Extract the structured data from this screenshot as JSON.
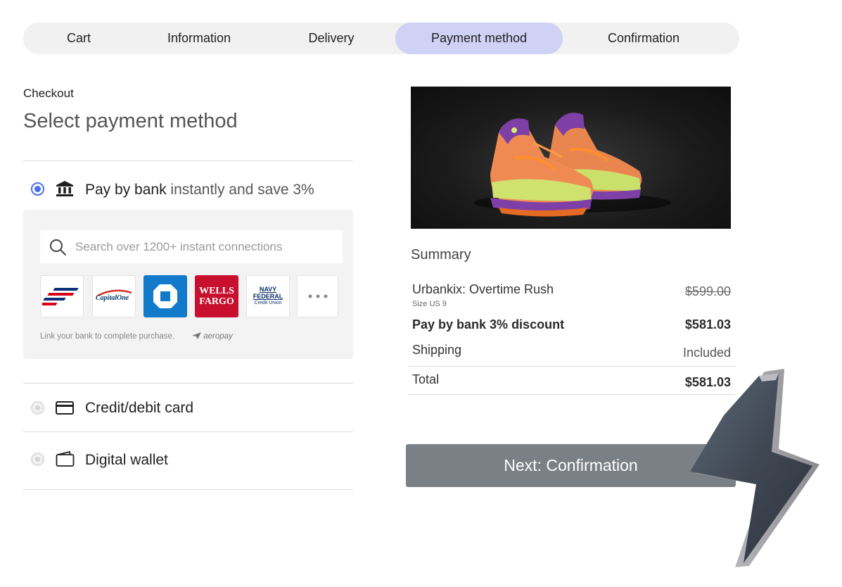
{
  "stepper": {
    "steps": [
      {
        "label": "Cart",
        "active": false
      },
      {
        "label": "Information",
        "active": false
      },
      {
        "label": "Delivery",
        "active": false
      },
      {
        "label": "Payment method",
        "active": true
      },
      {
        "label": "Confirmation",
        "active": false
      }
    ]
  },
  "checkout": {
    "eyebrow": "Checkout",
    "title": "Select payment method"
  },
  "methods": {
    "bank": {
      "label_strong": "Pay by bank",
      "label_soft": " instantly and save 3%",
      "selected": true,
      "icon": "bank-icon",
      "search_placeholder": "Search over 1200+ instant connections",
      "banks": [
        {
          "name": "Bank of America",
          "icon": "bank-of-america-logo"
        },
        {
          "name": "Capital One",
          "text": "CapitalOne"
        },
        {
          "name": "Chase",
          "icon": "chase-logo"
        },
        {
          "name": "Wells Fargo",
          "line1": "WELLS",
          "line2": "FARGO"
        },
        {
          "name": "Navy Federal Credit Union",
          "line1": "NAVY",
          "line2": "FEDERAL",
          "line3": "Credit Union"
        },
        {
          "name": "More banks",
          "icon": "more-dots-icon"
        }
      ],
      "footer_note": "Link your bank to complete purchase.",
      "provider": "aeropay"
    },
    "card": {
      "label": "Credit/debit card",
      "selected": false,
      "icon": "credit-card-icon"
    },
    "wallet": {
      "label": "Digital wallet",
      "selected": false,
      "icon": "wallet-icon"
    }
  },
  "summary": {
    "title": "Summary",
    "product_name": "Urbankix: Overtime Rush",
    "product_size": "Size US 9",
    "product_price": "$599.00",
    "discount_label": "Pay by bank 3% discount",
    "discount_price": "$581.03",
    "shipping_label": "Shipping",
    "shipping_value": "Included",
    "total_label": "Total",
    "total_value": "$581.03"
  },
  "next_button": {
    "label": "Next: Confirmation"
  },
  "colors": {
    "accent": "#4c6ef0",
    "active_step": "#cfd2f4",
    "button": "#7b8086",
    "wells_fargo": "#c8102e",
    "chase": "#117aca"
  }
}
